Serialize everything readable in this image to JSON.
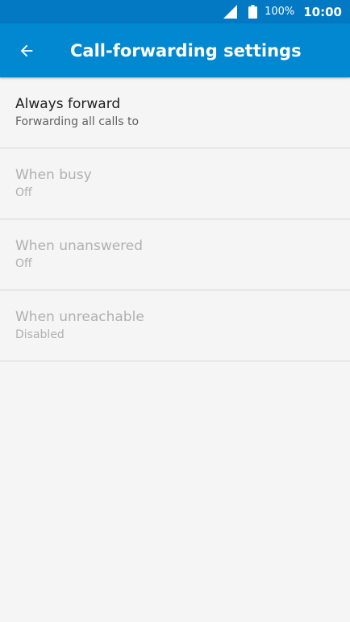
{
  "status_bar": {
    "battery_percent": "100%",
    "time": "10:00",
    "icons": [
      "signal-icon",
      "battery-icon"
    ]
  },
  "app_bar": {
    "title": "Call-forwarding settings",
    "back_icon": "arrow-back-icon"
  },
  "settings": [
    {
      "label": "Always forward",
      "summary": "Forwarding all calls to",
      "enabled": true
    },
    {
      "label": "When busy",
      "summary": "Off",
      "enabled": false
    },
    {
      "label": "When unanswered",
      "summary": "Off",
      "enabled": false
    },
    {
      "label": "When unreachable",
      "summary": "Disabled",
      "enabled": false
    }
  ],
  "colors": {
    "status_bar": "#0379c3",
    "app_bar": "#0288d1",
    "background": "#f5f5f5",
    "divider": "#d6d6d6",
    "disabled_text": "#b0b0b0"
  }
}
